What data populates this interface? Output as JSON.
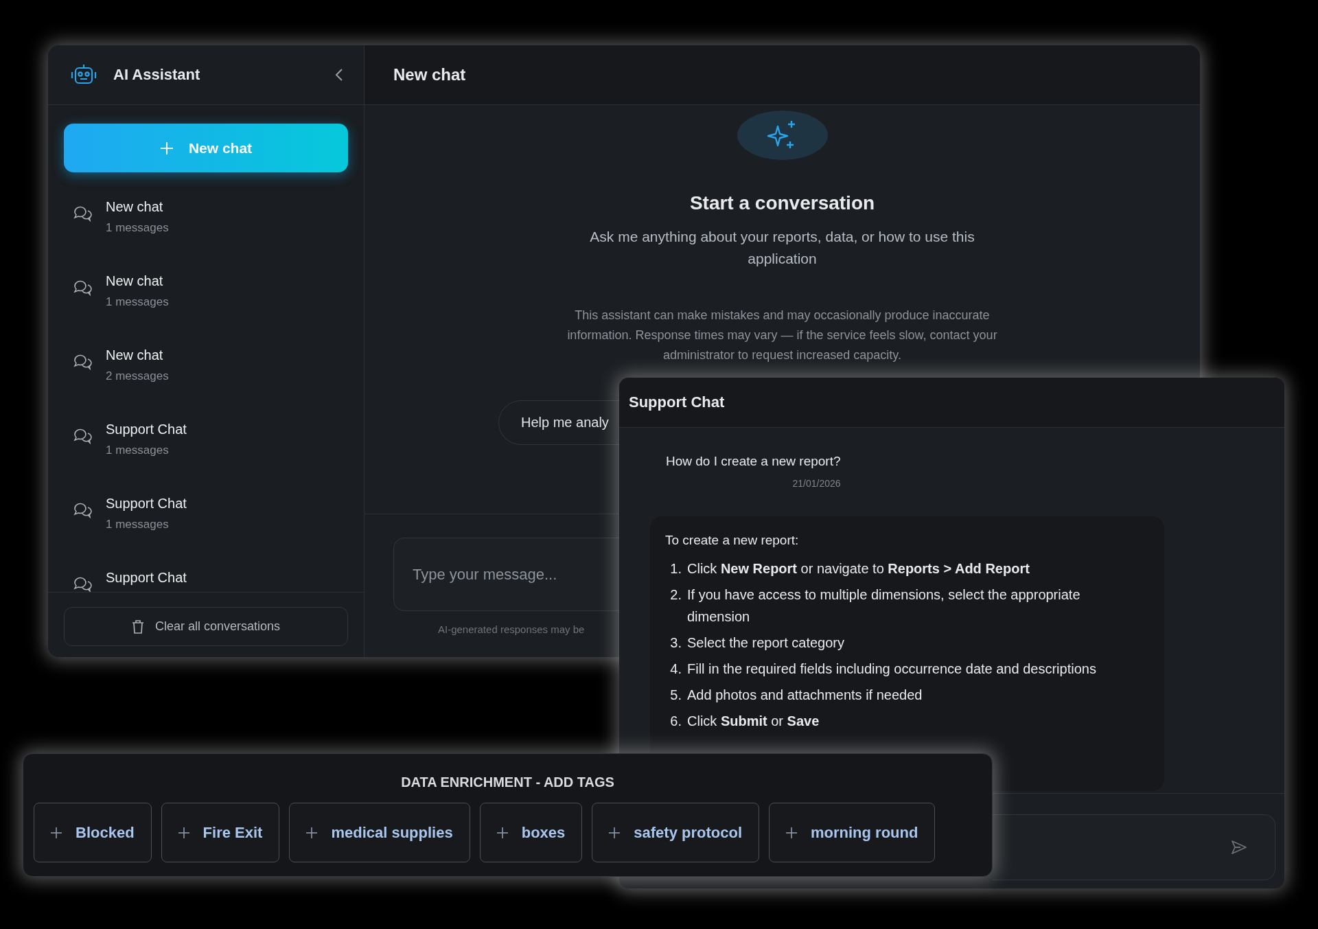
{
  "main_window": {
    "sidebar": {
      "app_title": "AI Assistant",
      "new_chat_button": "New chat",
      "conversations": [
        {
          "title": "New chat",
          "meta": "1 messages",
          "selected": false
        },
        {
          "title": "New chat",
          "meta": "1 messages",
          "selected": false
        },
        {
          "title": "New chat",
          "meta": "2 messages",
          "selected": false
        },
        {
          "title": "Support Chat",
          "meta": "1 messages",
          "selected": false
        },
        {
          "title": "Support Chat",
          "meta": "1 messages",
          "selected": false
        },
        {
          "title": "Support Chat",
          "selected": false
        }
      ],
      "clear_button": "Clear all conversations"
    },
    "chat": {
      "title": "New chat",
      "empty_state": {
        "heading": "Start a conversation",
        "subtitle": "Ask me anything about your reports, data, or how to use this application",
        "disclaimer": "This assistant can make mistakes and may occasionally produce inaccurate information. Response times may vary — if the service feels slow, contact your administrator to request increased capacity."
      },
      "suggestion_chip": "Help me analy",
      "input": {
        "placeholder": "Type your message..."
      },
      "footer_note": "AI-generated responses may be"
    }
  },
  "support_window": {
    "title": "Support Chat",
    "messages": [
      {
        "kind": "user",
        "text": "How do I create a new report?",
        "date": "21/01/2026"
      },
      {
        "kind": "assistant",
        "intro": "To create a new report:",
        "steps": [
          {
            "number": "1.",
            "text": "Click **New Report** or navigate to **Reports > Add Report**"
          },
          {
            "number": "2.",
            "text": "If you have access to multiple dimensions, select the appropriate dimension"
          },
          {
            "number": "3.",
            "text": "Select the report category"
          },
          {
            "number": "4.",
            "text": "Fill in the required fields including occurrence date and descriptions"
          },
          {
            "number": "5.",
            "text": "Add photos and attachments if needed"
          },
          {
            "number": "6.",
            "text": "Click **Submit** or **Save**"
          }
        ]
      }
    ]
  },
  "tags_panel": {
    "title": "DATA ENRICHMENT - ADD TAGS",
    "tags": [
      "Blocked",
      "Fire Exit",
      "medical supplies",
      "boxes",
      "safety protocol",
      "morning round"
    ]
  }
}
